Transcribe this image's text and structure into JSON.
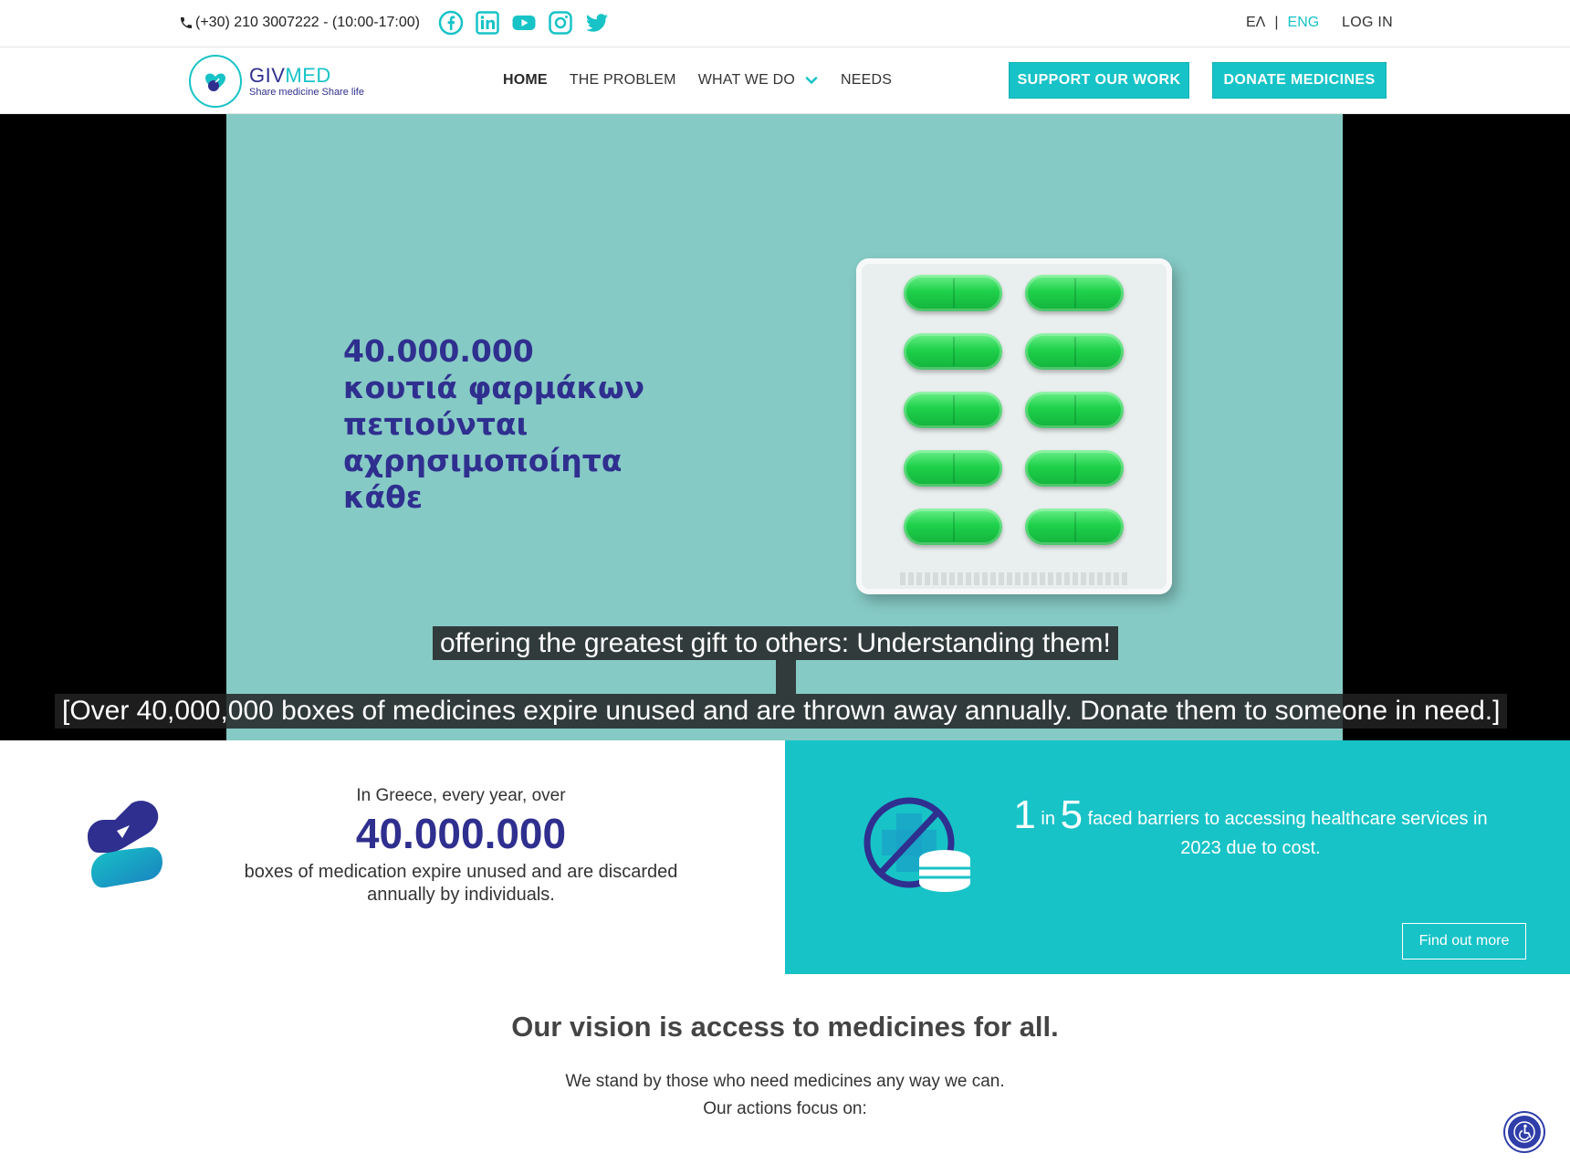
{
  "topbar": {
    "phone": "(+30) 210 3007222 - (10:00-17:00)",
    "socials": [
      "facebook-icon",
      "linkedin-icon",
      "youtube-icon",
      "instagram-icon",
      "twitter-icon"
    ],
    "lang_el": "ΕΛ",
    "lang_sep": "|",
    "lang_en": "ENG",
    "login": "LOG IN"
  },
  "nav": {
    "logo_name_a": "GIV",
    "logo_name_b": "MED",
    "logo_tagline": "Share medicine Share life",
    "items": [
      "HOME",
      "THE PROBLEM",
      "WHAT WE DO",
      "NEEDS"
    ],
    "support_button": "SUPPORT OUR WORK",
    "donate_button": "DONATE MEDICINES"
  },
  "hero": {
    "lines": [
      "40.000.000",
      "κουτιά φαρμάκων",
      "πετιούνται",
      "αχρησιμοποίητα",
      "κάθε"
    ],
    "caption_top": "offering the greatest gift to others: Understanding them!",
    "caption_bottom": "[Over 40,000,000 boxes of medicines expire unused and are thrown away annually. Donate them to someone in need.]"
  },
  "stats": {
    "left_pre": "In Greece, every year, over",
    "left_big": "40.000.000",
    "left_post": "boxes of medication expire unused and are discarded annually by individuals.",
    "right_num1": "1",
    "right_in": "in",
    "right_num2": "5",
    "right_text": "faced barriers to accessing healthcare services in 2023 due to cost.",
    "find_more": "Find out more"
  },
  "vision": {
    "title": "Our vision is access to medicines for all.",
    "line1": "We stand by those who need medicines any way we can.",
    "line2": "Our actions focus on:"
  },
  "colors": {
    "brand_teal": "#17c3c7",
    "brand_navy": "#2f2f8f",
    "hero_bg": "#86cac5"
  }
}
